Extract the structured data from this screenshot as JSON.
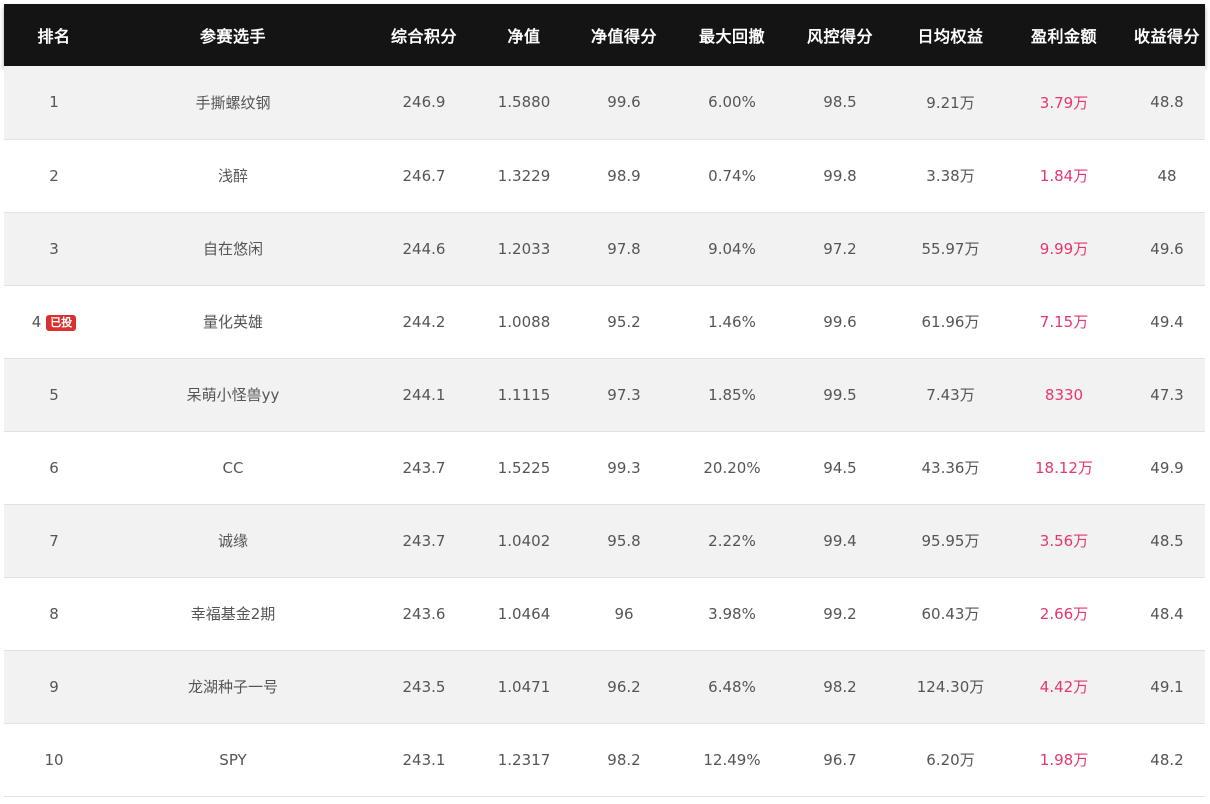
{
  "table": {
    "headers": [
      "排名",
      "参赛选手",
      "综合积分",
      "净值",
      "净值得分",
      "最大回撤",
      "风控得分",
      "日均权益",
      "盈利金额",
      "收益得分"
    ],
    "rows": [
      {
        "rank": "1",
        "badge": "",
        "player": "手撕螺纹钢",
        "score": "246.9",
        "nav": "1.5880",
        "nav_score": "99.6",
        "max_drawdown": "6.00%",
        "risk_score": "98.5",
        "avg_equity": "9.21万",
        "profit": "3.79万",
        "return_score": "48.8"
      },
      {
        "rank": "2",
        "badge": "",
        "player": "浅醉",
        "score": "246.7",
        "nav": "1.3229",
        "nav_score": "98.9",
        "max_drawdown": "0.74%",
        "risk_score": "99.8",
        "avg_equity": "3.38万",
        "profit": "1.84万",
        "return_score": "48"
      },
      {
        "rank": "3",
        "badge": "",
        "player": "自在悠闲",
        "score": "244.6",
        "nav": "1.2033",
        "nav_score": "97.8",
        "max_drawdown": "9.04%",
        "risk_score": "97.2",
        "avg_equity": "55.97万",
        "profit": "9.99万",
        "return_score": "49.6"
      },
      {
        "rank": "4",
        "badge": "已投",
        "player": "量化英雄",
        "score": "244.2",
        "nav": "1.0088",
        "nav_score": "95.2",
        "max_drawdown": "1.46%",
        "risk_score": "99.6",
        "avg_equity": "61.96万",
        "profit": "7.15万",
        "return_score": "49.4"
      },
      {
        "rank": "5",
        "badge": "",
        "player": "呆萌小怪兽yy",
        "score": "244.1",
        "nav": "1.1115",
        "nav_score": "97.3",
        "max_drawdown": "1.85%",
        "risk_score": "99.5",
        "avg_equity": "7.43万",
        "profit": "8330",
        "return_score": "47.3"
      },
      {
        "rank": "6",
        "badge": "",
        "player": "CC",
        "score": "243.7",
        "nav": "1.5225",
        "nav_score": "99.3",
        "max_drawdown": "20.20%",
        "risk_score": "94.5",
        "avg_equity": "43.36万",
        "profit": "18.12万",
        "return_score": "49.9"
      },
      {
        "rank": "7",
        "badge": "",
        "player": "诚缘",
        "score": "243.7",
        "nav": "1.0402",
        "nav_score": "95.8",
        "max_drawdown": "2.22%",
        "risk_score": "99.4",
        "avg_equity": "95.95万",
        "profit": "3.56万",
        "return_score": "48.5"
      },
      {
        "rank": "8",
        "badge": "",
        "player": "幸福基金2期",
        "score": "243.6",
        "nav": "1.0464",
        "nav_score": "96",
        "max_drawdown": "3.98%",
        "risk_score": "99.2",
        "avg_equity": "60.43万",
        "profit": "2.66万",
        "return_score": "48.4"
      },
      {
        "rank": "9",
        "badge": "",
        "player": "龙湖种子一号",
        "score": "243.5",
        "nav": "1.0471",
        "nav_score": "96.2",
        "max_drawdown": "6.48%",
        "risk_score": "98.2",
        "avg_equity": "124.30万",
        "profit": "4.42万",
        "return_score": "49.1"
      },
      {
        "rank": "10",
        "badge": "",
        "player": "SPY",
        "score": "243.1",
        "nav": "1.2317",
        "nav_score": "98.2",
        "max_drawdown": "12.49%",
        "risk_score": "96.7",
        "avg_equity": "6.20万",
        "profit": "1.98万",
        "return_score": "48.2"
      }
    ]
  },
  "colors": {
    "header_bg": "#141414",
    "header_text": "#ffffff",
    "odd_row_bg": "#f2f2f2",
    "even_row_bg": "#ffffff",
    "cell_text": "#555555",
    "profit_text": "#e6366e",
    "badge_bg": "#d93030"
  }
}
